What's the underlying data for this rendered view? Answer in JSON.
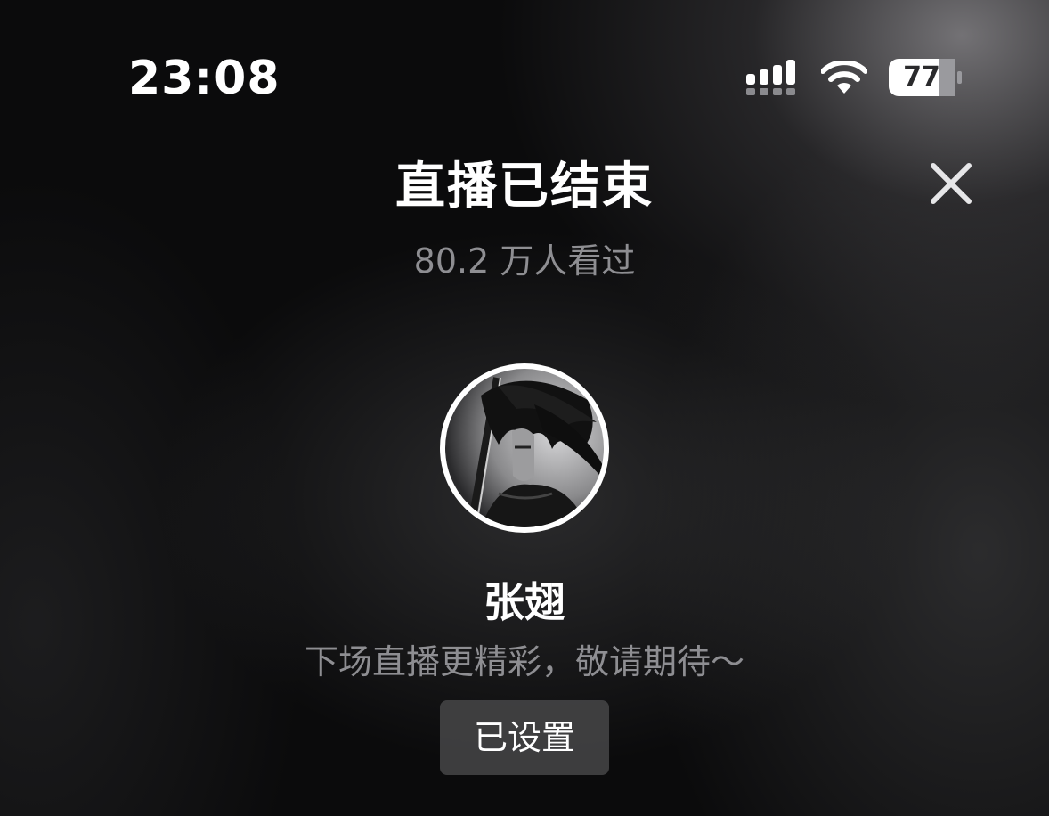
{
  "status_bar": {
    "time": "23:08",
    "battery_level": "77",
    "icons": [
      "signal-icon",
      "wifi-icon",
      "battery-icon"
    ]
  },
  "header": {
    "title": "直播已结束",
    "close_icon": "close-icon",
    "viewer_count": "80.2 万人看过"
  },
  "streamer": {
    "name": "张翅",
    "message": "下场直播更精彩，敬请期待～",
    "reminder_button_label": "已设置"
  },
  "colors": {
    "background": "#0b0b0c",
    "primary_text": "#ffffff",
    "secondary_text": "#8e8e92",
    "button_bg": "#464648"
  }
}
